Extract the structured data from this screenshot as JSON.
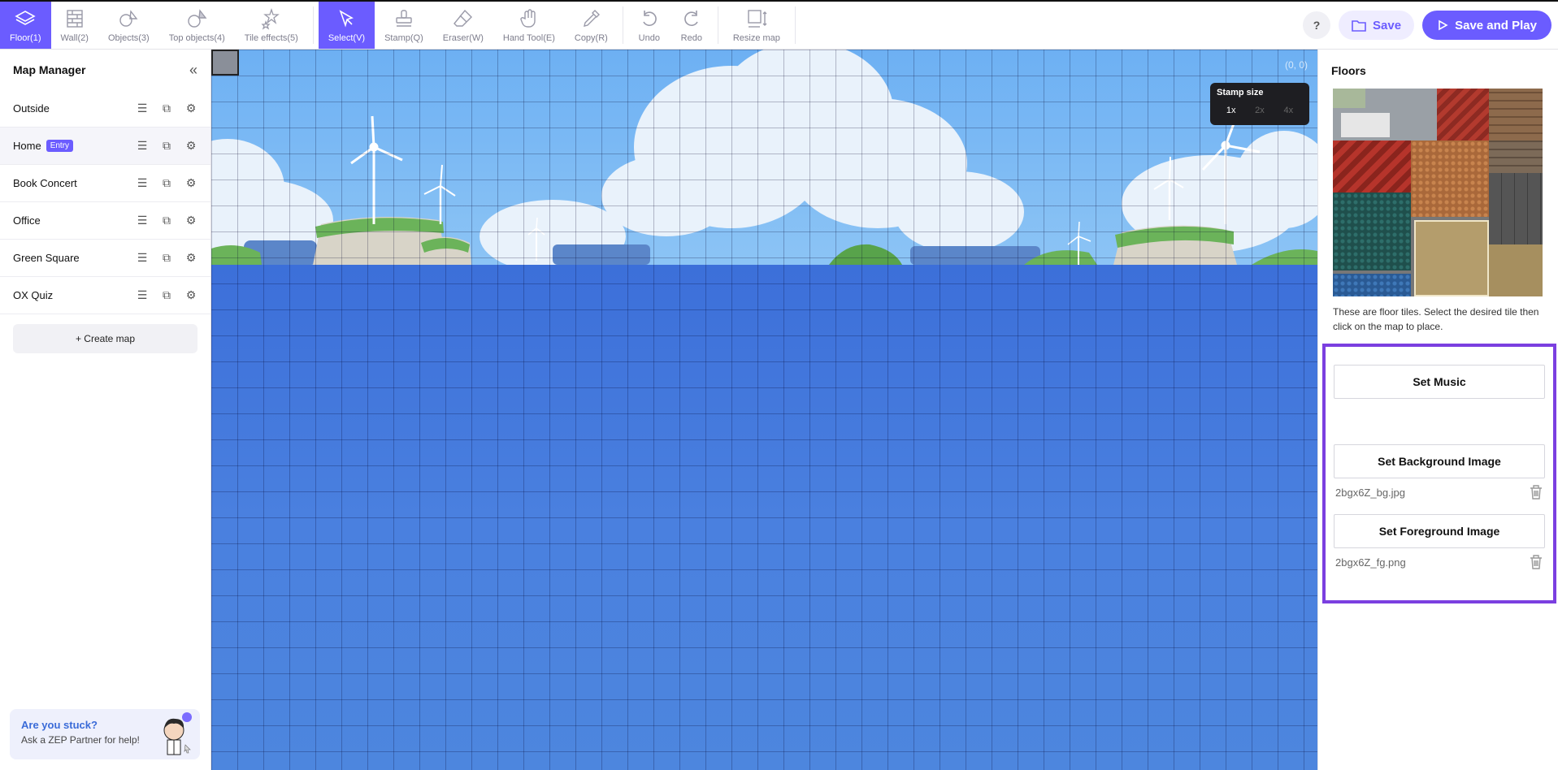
{
  "toolbar": {
    "tools": [
      {
        "label": "Floor(1)",
        "icon": "floor-layers-icon"
      },
      {
        "label": "Wall(2)",
        "icon": "wall-icon"
      },
      {
        "label": "Objects(3)",
        "icon": "objects-icon"
      },
      {
        "label": "Top objects(4)",
        "icon": "top-objects-icon"
      },
      {
        "label": "Tile effects(5)",
        "icon": "tile-effects-icon"
      },
      {
        "label": "Select(V)",
        "icon": "select-cursor-icon"
      },
      {
        "label": "Stamp(Q)",
        "icon": "stamp-icon"
      },
      {
        "label": "Eraser(W)",
        "icon": "eraser-icon"
      },
      {
        "label": "Hand Tool(E)",
        "icon": "hand-icon"
      },
      {
        "label": "Copy(R)",
        "icon": "eyedropper-icon"
      },
      {
        "label": "Undo",
        "icon": "undo-icon"
      },
      {
        "label": "Redo",
        "icon": "redo-icon"
      },
      {
        "label": "Resize map",
        "icon": "resize-icon"
      }
    ],
    "help": "?",
    "save_label": "Save",
    "save_play_label": "Save and Play"
  },
  "sidebar": {
    "title": "Map Manager",
    "maps": [
      {
        "name": "Outside",
        "entry": false
      },
      {
        "name": "Home",
        "entry": true
      },
      {
        "name": "Book Concert",
        "entry": false
      },
      {
        "name": "Office",
        "entry": false
      },
      {
        "name": "Green Square",
        "entry": false
      },
      {
        "name": "OX Quiz",
        "entry": false
      }
    ],
    "entry_badge": "Entry",
    "create_map_label": "+ Create map",
    "help_question": "Are you stuck?",
    "help_answer": "Ask a ZEP Partner for help!"
  },
  "canvas": {
    "coord": "(0, 0)",
    "stamp_size_title": "Stamp size",
    "stamp_options": [
      "1x",
      "2x",
      "4x"
    ],
    "stamp_selected": "1x"
  },
  "right_panel": {
    "title": "Floors",
    "description": "These are floor tiles. Select the desired tile then click on the map to place.",
    "set_music_label": "Set Music",
    "set_bg_label": "Set Background Image",
    "bg_file": "2bgx6Z_bg.jpg",
    "set_fg_label": "Set Foreground Image",
    "fg_file": "2bgx6Z_fg.png"
  },
  "colors": {
    "accent": "#6b5cff",
    "highlight_border": "#7b3fe0",
    "sky": "#6db0f3",
    "sea": "#3f74d6"
  }
}
